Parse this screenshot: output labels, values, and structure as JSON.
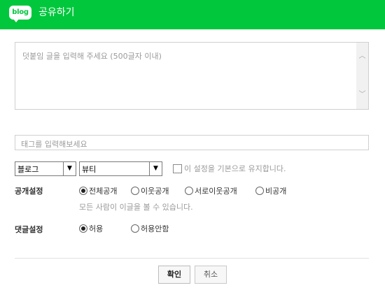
{
  "header": {
    "logo_text": "blog",
    "title": "공유하기",
    "bg_color": "#00c73c"
  },
  "editor": {
    "placeholder": "덧붙임 글을 입력해 주세요 (500글자 이내)"
  },
  "tag": {
    "placeholder": "태그를 입력해보세요"
  },
  "selects": {
    "target": {
      "value": "블로그"
    },
    "category": {
      "value": "뷰티"
    }
  },
  "default_checkbox": {
    "label": "이 설정을 기본으로 유지합니다.",
    "checked": false
  },
  "visibility": {
    "label": "공개설정",
    "options": [
      "전체공개",
      "이웃공개",
      "서로이웃공개",
      "비공개"
    ],
    "selected": "전체공개",
    "hint": "모든 사람이 이글을 볼 수 있습니다."
  },
  "comments": {
    "label": "댓글설정",
    "options": [
      "허용",
      "허용안함"
    ],
    "selected": "허용"
  },
  "buttons": {
    "confirm": "확인",
    "cancel": "취소"
  }
}
